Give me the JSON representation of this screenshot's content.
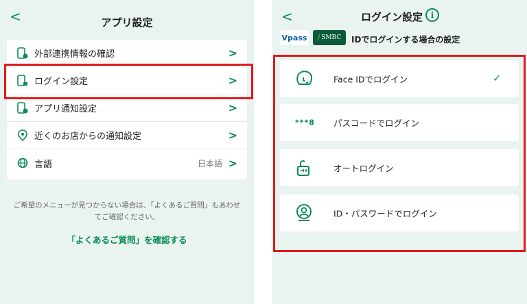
{
  "left_screen": {
    "title": "アプリ設定",
    "back_glyph": "<",
    "menu_items": [
      {
        "label": "外部連携情報の確認",
        "icon": "phone-link-icon",
        "value": "",
        "chevron": ">"
      },
      {
        "label": "ログイン設定",
        "icon": "phone-lock-icon",
        "value": "",
        "chevron": ">"
      },
      {
        "label": "アプリ通知設定",
        "icon": "phone-bell-icon",
        "value": "",
        "chevron": ">"
      },
      {
        "label": "近くのお店からの通知設定",
        "icon": "location-pin-icon",
        "value": "",
        "chevron": ">"
      },
      {
        "label": "言語",
        "icon": "globe-icon",
        "value": "日本語",
        "chevron": ">"
      }
    ],
    "help_text_line1": "ご希望のメニューが見つからない場合は、「よくあるご質問」もあわせ",
    "help_text_line2": "てご確認ください。",
    "faq_link": "「よくあるご質問」を確認する",
    "highlighted_item": "ログイン設定"
  },
  "right_screen": {
    "title": "ログイン設定",
    "back_glyph": "<",
    "info_glyph": "i",
    "vpass_logo": "Vpass",
    "smbc_logo": "SMBC",
    "subtitle": "IDでログインする場合の設定",
    "login_options": [
      {
        "label": "Face IDでログイン",
        "icon": "face-id-icon",
        "selected": true,
        "check": "✓"
      },
      {
        "label": "パスコードでログイン",
        "icon": "passcode-icon",
        "icon_text": "***8",
        "selected": false
      },
      {
        "label": "オートログイン",
        "icon": "auto-login-lock-icon",
        "selected": false
      },
      {
        "label": "ID・パスワードでログイン",
        "icon": "id-password-user-icon",
        "selected": false
      }
    ]
  },
  "colors": {
    "accent": "#0a8a57",
    "background": "#e9f4f0",
    "highlight_border": "#e01a1a"
  }
}
